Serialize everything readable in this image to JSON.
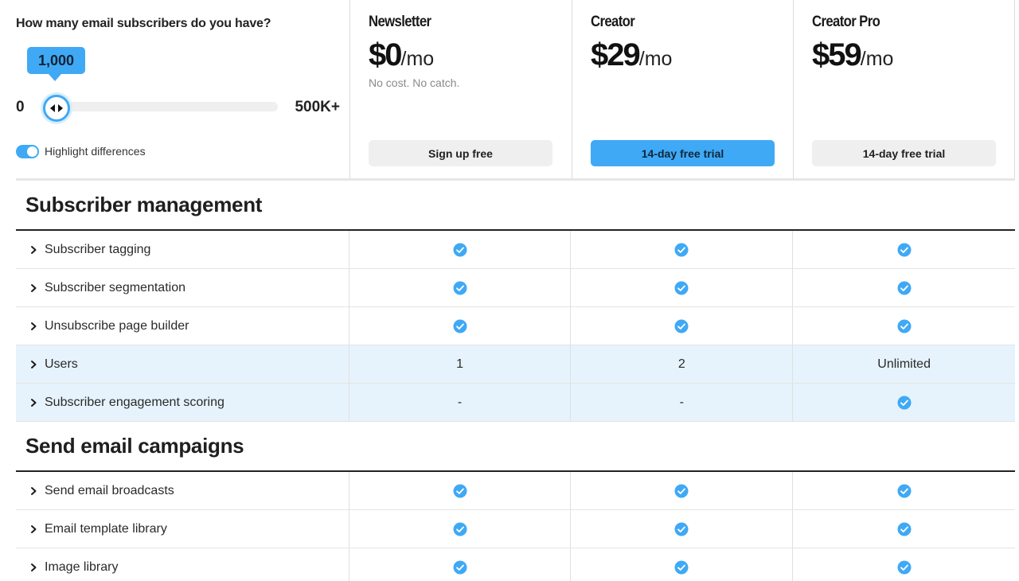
{
  "selector": {
    "question": "How many email subscribers do you have?",
    "current_value": "1,000",
    "min_label": "0",
    "max_label": "500K+",
    "slider_fraction": 0.07,
    "highlight_toggle_label": "Highlight differences",
    "highlight_on": true
  },
  "plans": [
    {
      "name": "Newsletter",
      "price": "$0",
      "per": "/mo",
      "note": "No cost. No catch.",
      "button": "Sign up free",
      "primary": false
    },
    {
      "name": "Creator",
      "price": "$29",
      "per": "/mo",
      "note": "",
      "button": "14-day free trial",
      "primary": true
    },
    {
      "name": "Creator Pro",
      "price": "$59",
      "per": "/mo",
      "note": "",
      "button": "14-day free trial",
      "primary": false
    }
  ],
  "sections": [
    {
      "title": "Subscriber management",
      "rows": [
        {
          "label": "Subscriber tagging",
          "values": [
            "check",
            "check",
            "check"
          ],
          "highlight": false
        },
        {
          "label": "Subscriber segmentation",
          "values": [
            "check",
            "check",
            "check"
          ],
          "highlight": false
        },
        {
          "label": "Unsubscribe page builder",
          "values": [
            "check",
            "check",
            "check"
          ],
          "highlight": false
        },
        {
          "label": "Users",
          "values": [
            "1",
            "2",
            "Unlimited"
          ],
          "highlight": true
        },
        {
          "label": "Subscriber engagement scoring",
          "values": [
            "-",
            "-",
            "check"
          ],
          "highlight": true
        }
      ]
    },
    {
      "title": "Send email campaigns",
      "rows": [
        {
          "label": "Send email broadcasts",
          "values": [
            "check",
            "check",
            "check"
          ],
          "highlight": false
        },
        {
          "label": "Email template library",
          "values": [
            "check",
            "check",
            "check"
          ],
          "highlight": false
        },
        {
          "label": "Image library",
          "values": [
            "check",
            "check",
            "check"
          ],
          "highlight": false
        }
      ]
    }
  ],
  "colors": {
    "accent": "#3fa9f5",
    "highlight_row": "#e6f3fc",
    "check": "#3fa9f5"
  },
  "icons": {
    "row_expand": "chevron-right-icon",
    "feature_included": "check-circle-icon",
    "slider_handle": "arrows-left-right-icon"
  }
}
